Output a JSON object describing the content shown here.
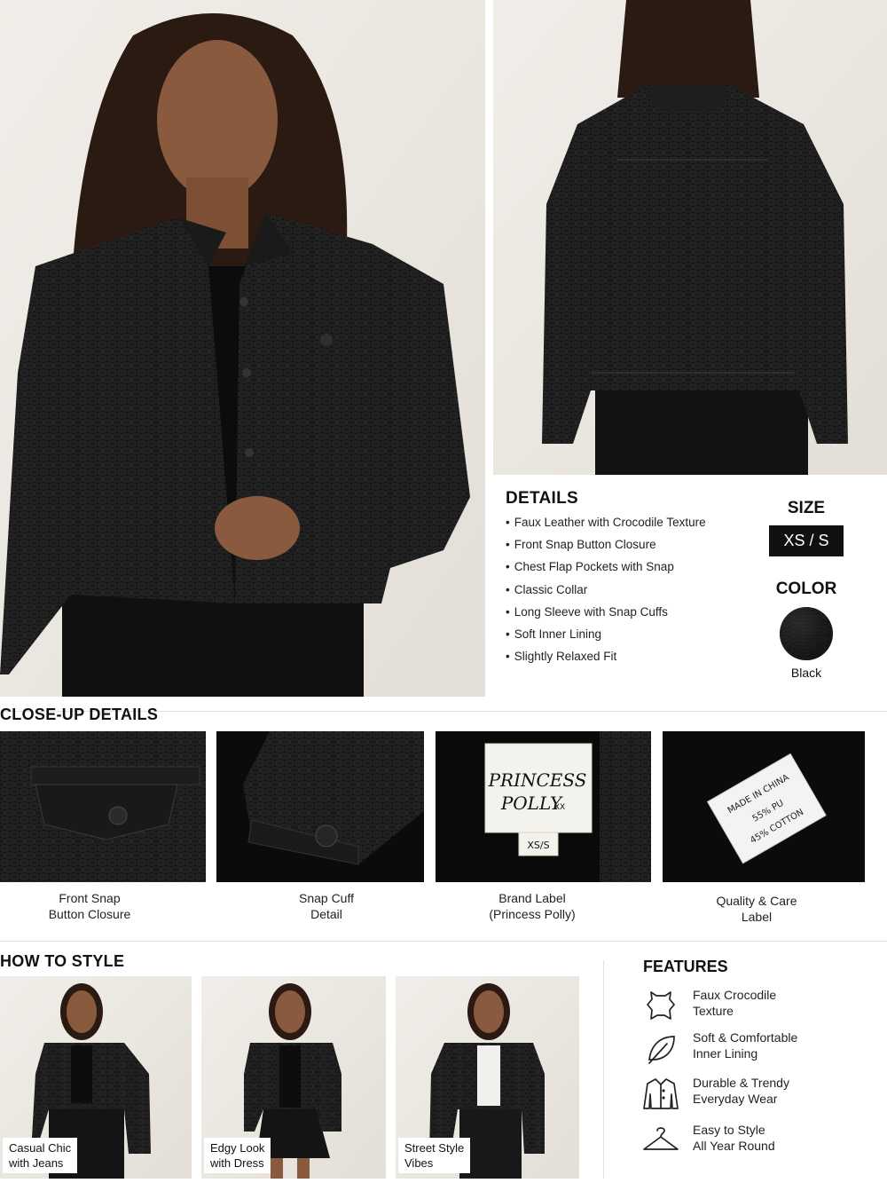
{
  "details": {
    "title": "DETAILS",
    "items": [
      "Faux Leather with Crocodile Texture",
      "Front Snap Button Closure",
      "Chest Flap Pockets with Snap",
      "Classic Collar",
      "Long Sleeve with Snap Cuffs",
      "Soft Inner Lining",
      "Slightly Relaxed Fit"
    ]
  },
  "size": {
    "title": "SIZE",
    "value": "XS / S"
  },
  "color": {
    "title": "COLOR",
    "name": "Black",
    "swatch": "#141414"
  },
  "closeups": {
    "title": "CLOSE-UP DETAILS",
    "items": [
      {
        "line1": "Front Snap",
        "line2": "Button Closure"
      },
      {
        "line1": "Snap Cuff",
        "line2": "Detail"
      },
      {
        "line1": "Brand Label",
        "line2": "(Princess Polly)"
      },
      {
        "line1": "Quality & Care",
        "line2": "Label"
      }
    ],
    "brand_label": {
      "line1": "PRINCESS",
      "line2": "POLLY",
      "mark": "XX",
      "size": "XS/S"
    },
    "care_label": {
      "line1": "MADE IN CHINA",
      "line2": "55% PU",
      "line3": "45% COTTON"
    }
  },
  "style": {
    "title": "HOW TO STYLE",
    "looks": [
      {
        "line1": "Casual Chic",
        "line2": "with Jeans"
      },
      {
        "line1": "Edgy Look",
        "line2": "with Dress"
      },
      {
        "line1": "Street Style",
        "line2": "Vibes"
      }
    ]
  },
  "features": {
    "title": "FEATURES",
    "items": [
      {
        "icon": "leather-hide-icon",
        "line1": "Faux Crocodile",
        "line2": "Texture"
      },
      {
        "icon": "leaf-icon",
        "line1": "Soft & Comfortable",
        "line2": "Inner Lining"
      },
      {
        "icon": "jacket-icon",
        "line1": "Durable & Trendy",
        "line2": "Everyday Wear"
      },
      {
        "icon": "hanger-icon",
        "line1": "Easy to Style",
        "line2": "All Year Round"
      }
    ]
  },
  "colors": {
    "jacket": "#111111",
    "background": "#ece8e3",
    "skin": "#8a5a3e",
    "hair": "#2b1a12"
  }
}
